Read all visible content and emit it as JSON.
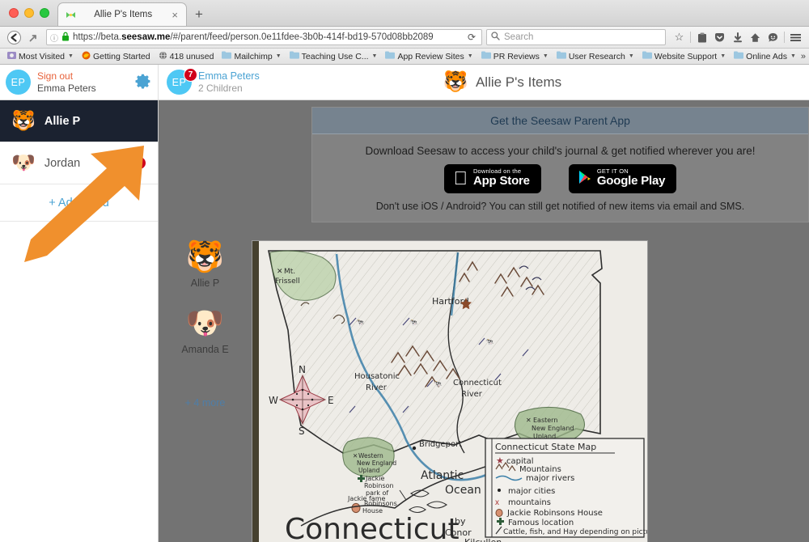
{
  "browser": {
    "tab": {
      "title": "Allie P's Items",
      "favicon_icon": "seesaw-icon",
      "close_icon": "close-icon"
    },
    "new_tab_label": "+",
    "nav": {
      "back_icon": "back-arrow-icon",
      "forward_icon": "forward-arrow-icon",
      "identity_icon": "info-icon",
      "lock_icon": "lock-icon",
      "reload_icon": "reload-icon",
      "url_prefix": "https://beta.",
      "url_bold": "seesaw.me",
      "url_suffix": "/#/parent/feed/person.0e11fdee-3b0b-414f-bd19-570d08bb2089"
    },
    "search": {
      "placeholder": "Search",
      "icon": "search-icon"
    },
    "toolbar_icons": [
      "star-icon",
      "reader-icon",
      "pocket-icon",
      "download-icon",
      "home-icon",
      "hello-icon",
      "hamburger-menu-icon"
    ],
    "bookmarks": [
      {
        "label": "Most Visited",
        "icon": "most-visited-icon",
        "has_caret": true
      },
      {
        "label": "Getting Started",
        "icon": "firefox-icon",
        "has_caret": false
      },
      {
        "label": "418 unused",
        "icon": "globe-icon",
        "has_caret": false
      },
      {
        "label": "Mailchimp",
        "icon": "folder-icon",
        "has_caret": true
      },
      {
        "label": "Teaching Use C...",
        "icon": "folder-icon",
        "has_caret": true
      },
      {
        "label": "App Review Sites",
        "icon": "folder-icon",
        "has_caret": true
      },
      {
        "label": "PR Reviews",
        "icon": "folder-icon",
        "has_caret": true
      },
      {
        "label": "User Research",
        "icon": "folder-icon",
        "has_caret": true
      },
      {
        "label": "Website Support",
        "icon": "folder-icon",
        "has_caret": true
      },
      {
        "label": "Online Ads",
        "icon": "folder-icon",
        "has_caret": true
      }
    ],
    "bookmarks_overflow": "»"
  },
  "app": {
    "account": {
      "avatar_initials": "EP",
      "sign_out_label": "Sign out",
      "user_name": "Emma Peters",
      "settings_icon": "gear-icon"
    },
    "person": {
      "avatar_initials": "EP",
      "badge_count": "7",
      "name": "Emma Peters",
      "children_count_label": "2 Children"
    },
    "header": {
      "emoji": "🐯",
      "title": "Allie P's Items"
    },
    "sidebar": {
      "children": [
        {
          "emoji": "🐯",
          "name": "Allie P",
          "selected": true,
          "badge": ""
        },
        {
          "emoji": "🐶",
          "name": "Jordan",
          "selected": false,
          "badge": "7"
        }
      ],
      "add_child_label": "+ Add Child"
    },
    "promo": {
      "heading": "Get the Seesaw Parent App",
      "description": "Download Seesaw to access your child's journal & get notified wherever you are!",
      "app_store": {
        "small": "Download on the",
        "big": "App Store",
        "icon": "apple-icon"
      },
      "google_play": {
        "small": "GET IT ON",
        "big": "Google Play",
        "icon": "play-icon"
      },
      "footnote": "Don't use iOS / Android? You can still get notified of new items via email and SMS."
    },
    "post": {
      "students": [
        {
          "emoji": "🐯",
          "name": "Allie P"
        },
        {
          "emoji": "🐶",
          "name": "Amanda E"
        }
      ],
      "more_label": "+ 4 more"
    },
    "drawing": {
      "title": "Connecticut",
      "byline_by": "by",
      "byline_first": "Conor",
      "byline_last": "Kilcullen",
      "place_labels": [
        "Mt. Frissell",
        "Hartford",
        "Housatonic River",
        "Connecticut River",
        "Bridgeport",
        "Atlantic Ocean",
        "Eastern New England Upland",
        "Western New England Upland",
        "Jackie Robinson park of fame",
        "Jackie Robinsons House"
      ],
      "compass": {
        "n": "N",
        "s": "S",
        "e": "E",
        "w": "W"
      },
      "legend": {
        "title": "Connecticut State Map",
        "entries": [
          {
            "symbol": "★",
            "label": "capital"
          },
          {
            "symbol": "^^^",
            "label": "Mountains"
          },
          {
            "symbol": "~~~",
            "label": "major rivers"
          },
          {
            "symbol": "•",
            "label": "major cities"
          },
          {
            "symbol": "x",
            "label": "mountains"
          },
          {
            "symbol": "◯",
            "label": "Jackie Robinsons House"
          },
          {
            "symbol": "✤",
            "label": "Famous location"
          },
          {
            "symbol": "/",
            "label": "Cattle, fish, and Hay depending on picture"
          }
        ]
      }
    },
    "annotation": {
      "arrow_icon": "orange-arrow-icon",
      "color": "#f0902d"
    }
  }
}
